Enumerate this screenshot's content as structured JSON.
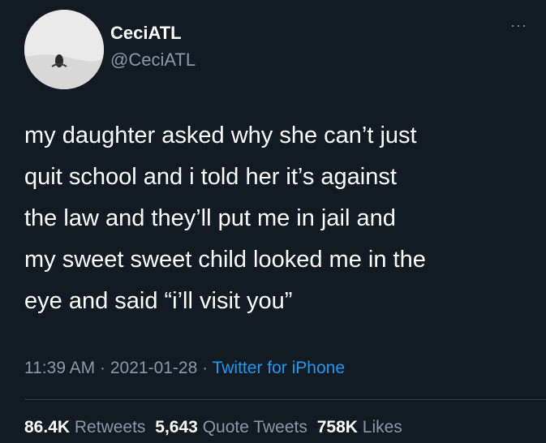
{
  "user": {
    "display_name": "CeciATL",
    "handle": "@CeciATL"
  },
  "more_menu": {
    "icon": "more-dots-icon",
    "glyph": "···"
  },
  "tweet": {
    "lines": [
      "my daughter asked why she can’t just",
      "quit school and i told her it’s against",
      "the law and they’ll put me in jail and",
      "my sweet sweet child looked me in the",
      "eye and said “i’ll visit you”"
    ]
  },
  "meta": {
    "time": "11:39 AM",
    "separator": "·",
    "date": "2021-01-28",
    "source": "Twitter for iPhone"
  },
  "stats": {
    "retweets_count": "86.4K",
    "retweets_label": "Retweets",
    "quotes_count": "5,643",
    "quotes_label": "Quote Tweets",
    "likes_count": "758K",
    "likes_label": "Likes"
  },
  "colors": {
    "background": "#121a24",
    "text": "#ffffff",
    "secondary": "#8b98a5",
    "link": "#1d9bf0"
  }
}
